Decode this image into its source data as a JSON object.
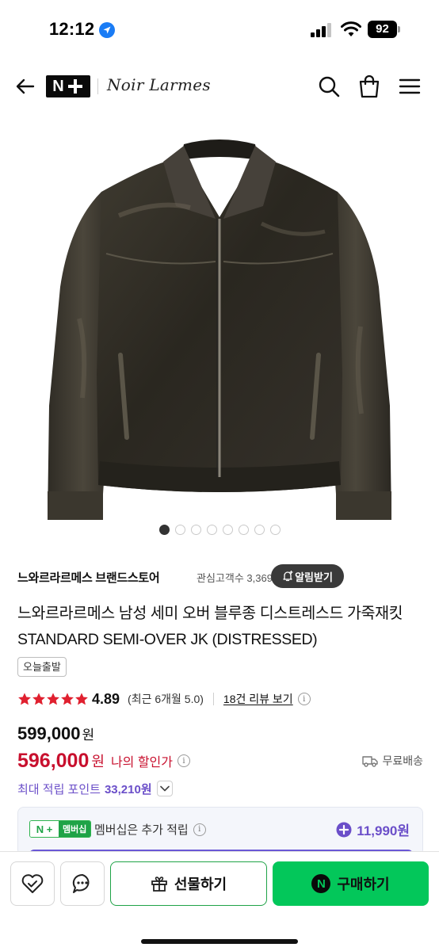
{
  "status_bar": {
    "time": "12:12",
    "battery": "92"
  },
  "header": {
    "logo": "N",
    "brand": "Noir Larmes"
  },
  "carousel": {
    "count": 8,
    "active_index": 0
  },
  "store": {
    "name": "느와르라르메스 브랜드스토어",
    "followers": "관심고객수 3,369",
    "alert_label": "알림받기"
  },
  "product": {
    "title": "느와르라르메스 남성 세미 오버 블루종 디스트레스드 가죽재킷 STANDARD SEMI-OVER JK (DISTRESSED)",
    "shipping_tag": "오늘출발"
  },
  "rating": {
    "stars": 5,
    "value": "4.89",
    "recent": "(최근 6개월 5.0)",
    "reviews": "18건 리뷰 보기",
    "info": "i"
  },
  "price": {
    "original": "599,000",
    "original_unit": "원",
    "sale": "596,000",
    "sale_unit": "원",
    "discount_label": "나의 할인가",
    "info": "i",
    "shipping": "무료배송"
  },
  "points": {
    "label": "최대 적립 포인트",
    "value": "33,210원"
  },
  "membership": {
    "badge_left": "N",
    "badge_right": "멤버십",
    "text": "멤버십은 추가 적립",
    "info": "i",
    "points": "11,990원"
  },
  "bottom": {
    "gift_label": "선물하기",
    "buy_label": "구매하기",
    "buy_icon": "N"
  },
  "colors": {
    "accent_green": "#03c75a",
    "sale_red": "#c8102e",
    "points_purple": "#6b4fc9",
    "star": "#e0202f"
  }
}
